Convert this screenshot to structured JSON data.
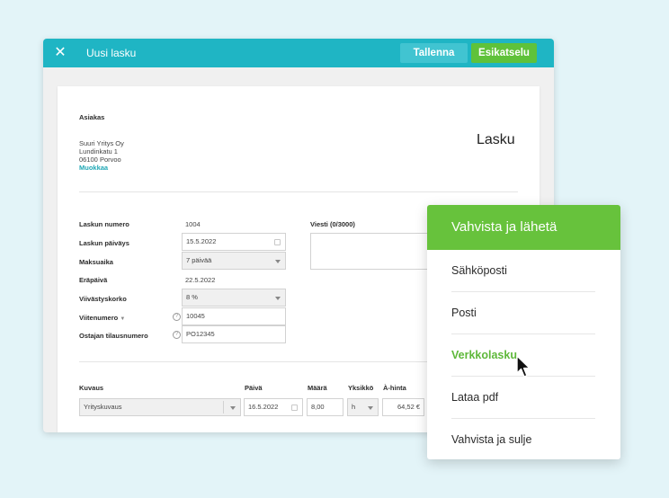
{
  "window": {
    "title": "Uusi lasku",
    "save_label": "Tallenna",
    "preview_label": "Esikatselu"
  },
  "invoice": {
    "customer_label": "Asiakas",
    "customer_name": "Suuri Yritys Oy",
    "customer_street": "Lundinkatu 1",
    "customer_city": "06100 Porvoo",
    "edit_link": "Muokkaa",
    "doc_title": "Lasku",
    "fields": {
      "number_label": "Laskun numero",
      "number_value": "1004",
      "date_label": "Laskun päiväys",
      "date_value": "15.5.2022",
      "terms_label": "Maksuaika",
      "terms_value": "7 päivää",
      "due_label": "Eräpäivä",
      "due_value": "22.5.2022",
      "interest_label": "Viivästyskorko",
      "interest_value": "8 %",
      "reference_label": "Viitenumero",
      "reference_value": "10045",
      "order_label": "Ostajan tilausnumero",
      "order_value": "PO12345",
      "message_label": "Viesti (0/3000)"
    },
    "rows": {
      "headers": {
        "description": "Kuvaus",
        "date": "Päivä",
        "quantity": "Määrä",
        "unit": "Yksikkö",
        "unit_price": "À-hinta"
      },
      "values": {
        "description": "Yrityskuvaus",
        "date": "16.5.2022",
        "quantity": "8,00",
        "unit": "h",
        "unit_price": "64,52 €"
      }
    }
  },
  "menu": {
    "header": "Vahvista ja lähetä",
    "items": [
      "Sähköposti",
      "Posti",
      "Verkkolasku",
      "Lataa pdf",
      "Vahvista ja sulje"
    ],
    "active_index": 2,
    "accent_color": "#67c23c"
  },
  "colors": {
    "topbar": "#1fb5c4",
    "background": "#e3f4f8",
    "save_button": "#41c4d1",
    "preview_button": "#5fc23a"
  }
}
